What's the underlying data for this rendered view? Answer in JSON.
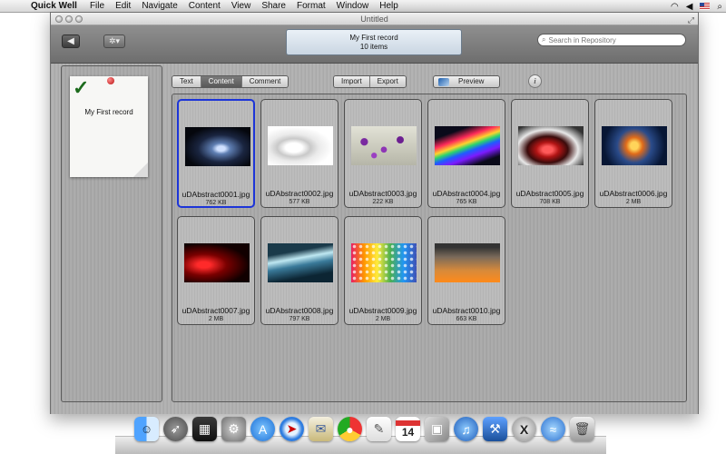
{
  "menubar": {
    "app_name": "Quick Well",
    "items": [
      "File",
      "Edit",
      "Navigate",
      "Content",
      "View",
      "Share",
      "Format",
      "Window",
      "Help"
    ]
  },
  "window": {
    "title": "Untitled",
    "record_title": "My First record",
    "record_count": "10 items",
    "search_placeholder": "Search in Repository"
  },
  "sidebar": {
    "note_title": "My First record"
  },
  "view_tabs": [
    "Text",
    "Content",
    "Comment"
  ],
  "active_tab": "Content",
  "io_buttons": [
    "Import",
    "Export"
  ],
  "preview_label": "Preview",
  "info_label": "i",
  "files": [
    {
      "name": "uDAbstract0001.jpg",
      "size": "762 KB",
      "selected": true
    },
    {
      "name": "uDAbstract0002.jpg",
      "size": "577 KB"
    },
    {
      "name": "uDAbstract0003.jpg",
      "size": "222 KB"
    },
    {
      "name": "uDAbstract0004.jpg",
      "size": "765 KB"
    },
    {
      "name": "uDAbstract0005.jpg",
      "size": "708 KB"
    },
    {
      "name": "uDAbstract0006.jpg",
      "size": "2 MB"
    },
    {
      "name": "uDAbstract0007.jpg",
      "size": "2 MB"
    },
    {
      "name": "uDAbstract0008.jpg",
      "size": "797 KB"
    },
    {
      "name": "uDAbstract0009.jpg",
      "size": "2 MB"
    },
    {
      "name": "uDAbstract0010.jpg",
      "size": "663 KB"
    }
  ],
  "dock": {
    "calendar_day": "14",
    "icons": [
      "finder-icon",
      "launchpad-icon",
      "dashboard-icon",
      "system-preferences-icon",
      "app-store-icon",
      "safari-icon",
      "mail-icon",
      "chrome-icon",
      "textedit-icon",
      "calendar-icon",
      "photo-booth-icon",
      "itunes-icon",
      "xcode-icon",
      "x11-icon",
      "quick-well-icon",
      "trash-icon"
    ]
  },
  "colors": {
    "selection_border": "#1d35d8",
    "active_tab_bg": "#636363"
  }
}
